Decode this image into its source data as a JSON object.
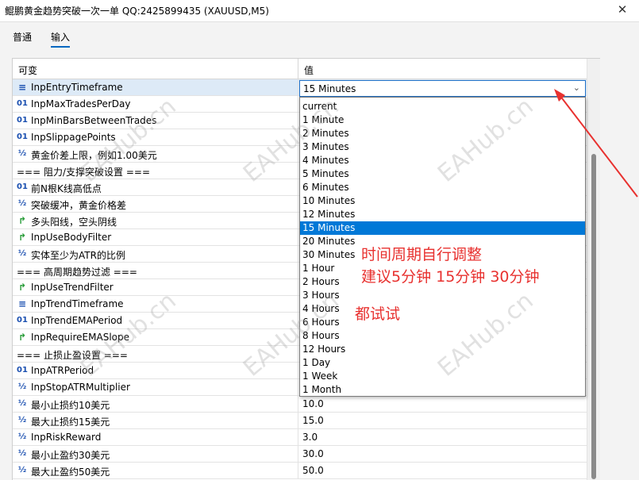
{
  "window": {
    "title": "鲲鹏黄金趋势突破一次一单 QQ:2425899435 (XAUUSD,M5)",
    "close_glyph": "✕"
  },
  "tabs": [
    {
      "label": "普通"
    },
    {
      "label": "输入"
    }
  ],
  "table": {
    "headers": {
      "name": "可变",
      "value": "值"
    },
    "rows": [
      {
        "icon": "enum",
        "name": "InpEntryTimeframe",
        "value": ""
      },
      {
        "icon": "int",
        "name": "InpMaxTradesPerDay",
        "value": ""
      },
      {
        "icon": "int",
        "name": "InpMinBarsBetweenTrades",
        "value": ""
      },
      {
        "icon": "int",
        "name": "InpSlippagePoints",
        "value": ""
      },
      {
        "icon": "double",
        "name": "黄金价差上限，例如1.00美元",
        "value": ""
      },
      {
        "icon": "none",
        "name": "=== 阻力/支撑突破设置 ===",
        "value": ""
      },
      {
        "icon": "int",
        "name": "前N根K线高低点",
        "value": ""
      },
      {
        "icon": "double",
        "name": "突破缓冲，黄金价格差",
        "value": ""
      },
      {
        "icon": "bool",
        "name": "多头阳线，空头阴线",
        "value": ""
      },
      {
        "icon": "bool",
        "name": "InpUseBodyFilter",
        "value": ""
      },
      {
        "icon": "double",
        "name": "实体至少为ATR的比例",
        "value": ""
      },
      {
        "icon": "none",
        "name": "=== 高周期趋势过滤 ===",
        "value": ""
      },
      {
        "icon": "bool",
        "name": "InpUseTrendFilter",
        "value": ""
      },
      {
        "icon": "enum",
        "name": "InpTrendTimeframe",
        "value": ""
      },
      {
        "icon": "int",
        "name": "InpTrendEMAPeriod",
        "value": ""
      },
      {
        "icon": "bool",
        "name": "InpRequireEMASlope",
        "value": ""
      },
      {
        "icon": "none",
        "name": "=== 止损止盈设置 ===",
        "value": ""
      },
      {
        "icon": "int",
        "name": "InpATRPeriod",
        "value": ""
      },
      {
        "icon": "double",
        "name": "InpStopATRMultiplier",
        "value": ""
      },
      {
        "icon": "double",
        "name": "最小止损约10美元",
        "value": "10.0"
      },
      {
        "icon": "double",
        "name": "最大止损约15美元",
        "value": "15.0"
      },
      {
        "icon": "double",
        "name": "InpRiskReward",
        "value": "3.0"
      },
      {
        "icon": "double",
        "name": "最小止盈约30美元",
        "value": "30.0"
      },
      {
        "icon": "double",
        "name": "最大止盈约50美元",
        "value": "50.0"
      }
    ]
  },
  "icon_glyphs": {
    "int": "01",
    "double": "½",
    "bool": "↱",
    "enum": "≡",
    "none": ""
  },
  "combo": {
    "selected": "15 Minutes",
    "chevron": "⌄"
  },
  "dropdown": {
    "options": [
      "current",
      "1 Minute",
      "2 Minutes",
      "3 Minutes",
      "4 Minutes",
      "5 Minutes",
      "6 Minutes",
      "10 Minutes",
      "12 Minutes",
      "15 Minutes",
      "20 Minutes",
      "30 Minutes",
      "1 Hour",
      "2 Hours",
      "3 Hours",
      "4 Hours",
      "6 Hours",
      "8 Hours",
      "12 Hours",
      "1 Day",
      "1 Week",
      "1 Month"
    ],
    "highlighted_index": 9
  },
  "annotations": {
    "line1": "时间周期自行调整",
    "line2": "建议5分钟 15分钟 30分钟",
    "line3": "都试试",
    "color": "#e8312f"
  },
  "watermark": "EAHub.cn"
}
